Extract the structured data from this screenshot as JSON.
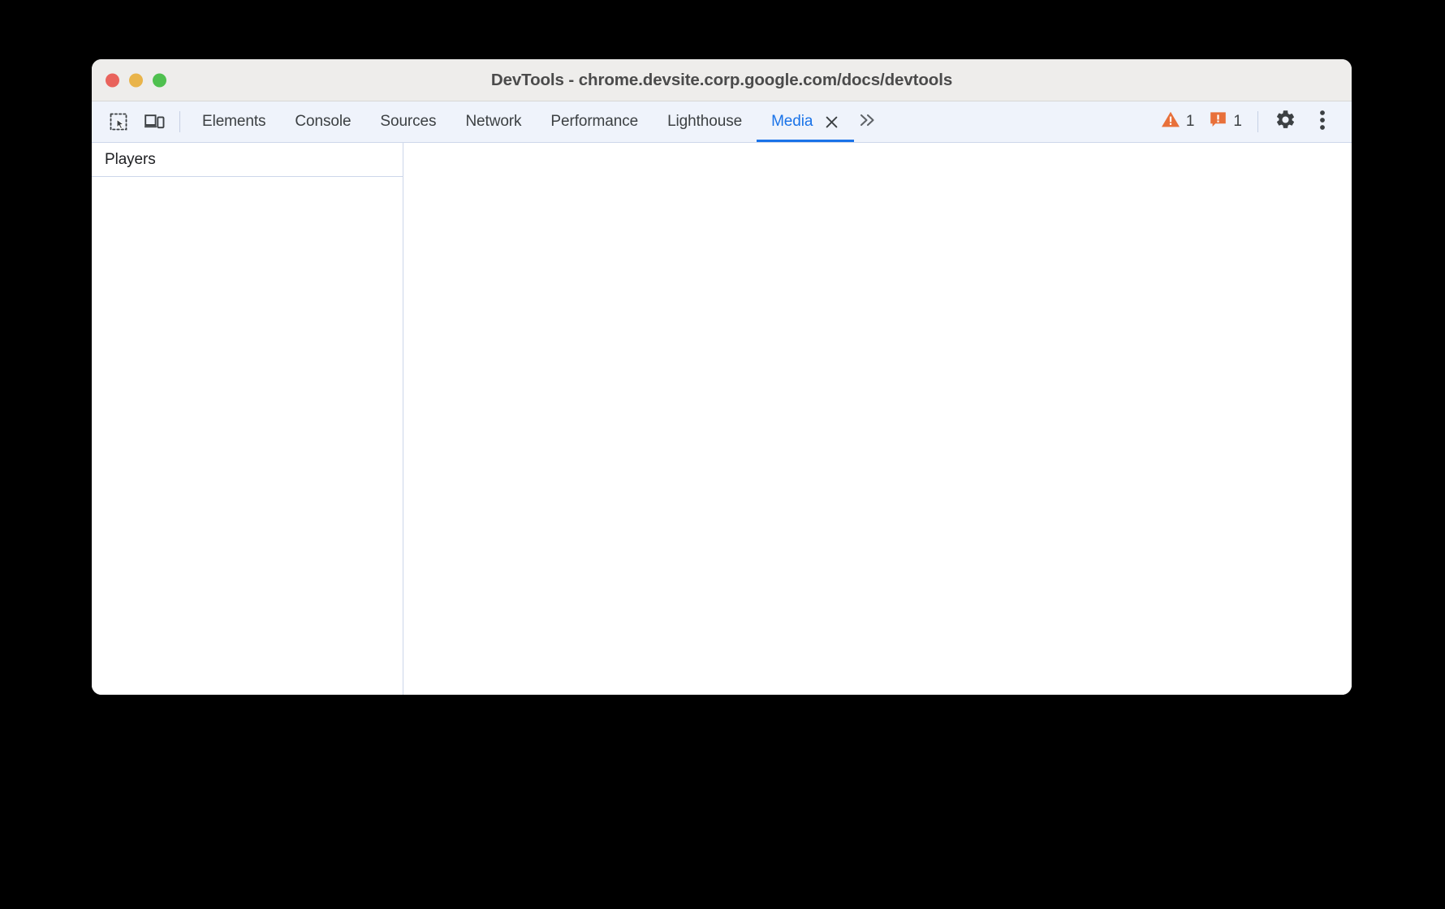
{
  "window": {
    "title": "DevTools - chrome.devsite.corp.google.com/docs/devtools",
    "traffic_lights": [
      {
        "name": "close",
        "color": "#e9635c"
      },
      {
        "name": "minimize",
        "color": "#e9b44a"
      },
      {
        "name": "maximize",
        "color": "#4fc04f"
      }
    ]
  },
  "toolbar": {
    "inspect_icon": "inspect-element-icon",
    "device_icon": "device-toolbar-icon",
    "tabs": [
      {
        "label": "Elements",
        "selected": false
      },
      {
        "label": "Console",
        "selected": false
      },
      {
        "label": "Sources",
        "selected": false
      },
      {
        "label": "Network",
        "selected": false
      },
      {
        "label": "Performance",
        "selected": false
      },
      {
        "label": "Lighthouse",
        "selected": false
      },
      {
        "label": "Media",
        "selected": true
      }
    ],
    "close_tab_label": "×",
    "overflow_label": "»",
    "warnings": {
      "icon": "warning-triangle-icon",
      "count": "1",
      "color": "#e8703a"
    },
    "issues": {
      "icon": "issue-square-icon",
      "count": "1",
      "color": "#e8703a"
    },
    "settings_icon": "gear-icon",
    "more_icon": "three-dot-menu-icon"
  },
  "media_panel": {
    "sidebar": {
      "header": "Players",
      "items": []
    },
    "main": {
      "content": ""
    }
  },
  "colors": {
    "accent": "#1a73e8",
    "tabbar_bg": "#eff3fb",
    "titlebar_bg": "#eeedeb",
    "border": "#cdd7ea",
    "text": "#3c4043"
  }
}
